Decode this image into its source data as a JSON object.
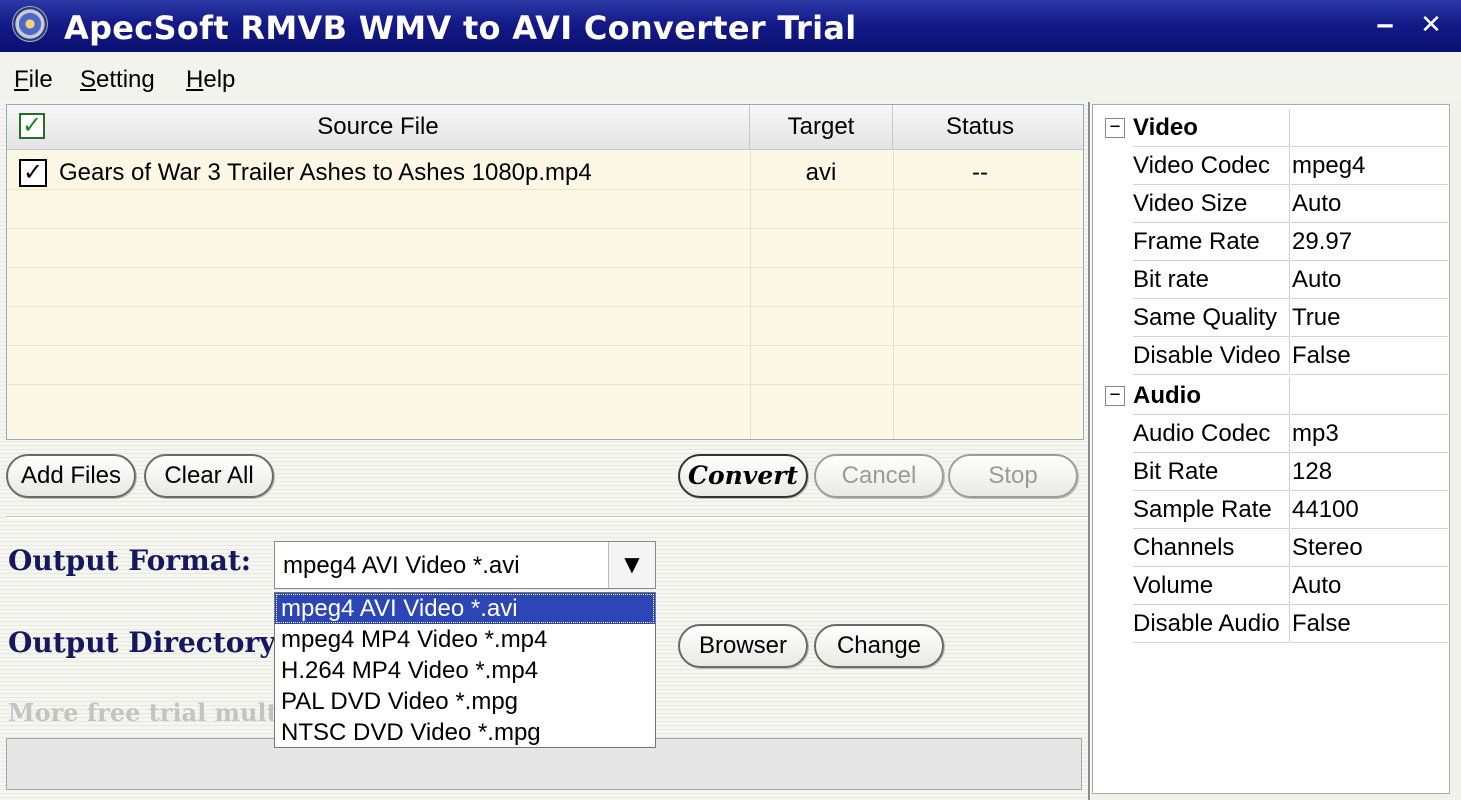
{
  "window": {
    "title": "ApecSoft RMVB WMV to AVI Converter Trial",
    "minimize_glyph": "‒",
    "close_glyph": "✕"
  },
  "menu": [
    {
      "accel": "F",
      "rest": "ile"
    },
    {
      "accel": "S",
      "rest": "etting"
    },
    {
      "accel": "H",
      "rest": "elp"
    }
  ],
  "file_list": {
    "columns": [
      "Source File",
      "Target",
      "Status"
    ],
    "rows": [
      {
        "checked": true,
        "source": "Gears of War 3 Trailer Ashes to Ashes 1080p.mp4",
        "target": "avi",
        "status": "--"
      }
    ]
  },
  "buttons": {
    "add_files": "Add Files",
    "clear_all": "Clear All",
    "convert": "Convert",
    "cancel": "Cancel",
    "stop": "Stop",
    "browser": "Browser",
    "change": "Change"
  },
  "output": {
    "format_label": "Output Format:",
    "directory_label": "Output Directory:",
    "selected_format": "mpeg4 AVI Video *.avi",
    "format_options": [
      "mpeg4 AVI Video *.avi",
      "mpeg4 MP4 Video *.mp4",
      "H.264 MP4 Video *.mp4",
      "PAL DVD Video *.mpg",
      "NTSC DVD Video *.mpg"
    ]
  },
  "more_text": "More free trial multi",
  "properties": {
    "video": {
      "title": "Video",
      "items": [
        {
          "name": "Video Codec",
          "value": "mpeg4"
        },
        {
          "name": "Video Size",
          "value": "Auto"
        },
        {
          "name": "Frame Rate",
          "value": "29.97"
        },
        {
          "name": "Bit rate",
          "value": "Auto"
        },
        {
          "name": "Same Quality",
          "value": "True"
        },
        {
          "name": "Disable Video",
          "value": "False"
        }
      ]
    },
    "audio": {
      "title": "Audio",
      "items": [
        {
          "name": "Audio Codec",
          "value": "mp3"
        },
        {
          "name": "Bit Rate",
          "value": "128"
        },
        {
          "name": "Sample Rate",
          "value": "44100"
        },
        {
          "name": "Channels",
          "value": "Stereo"
        },
        {
          "name": "Volume",
          "value": "Auto"
        },
        {
          "name": "Disable Audio",
          "value": "False"
        }
      ]
    },
    "collapse_glyph": "−"
  }
}
